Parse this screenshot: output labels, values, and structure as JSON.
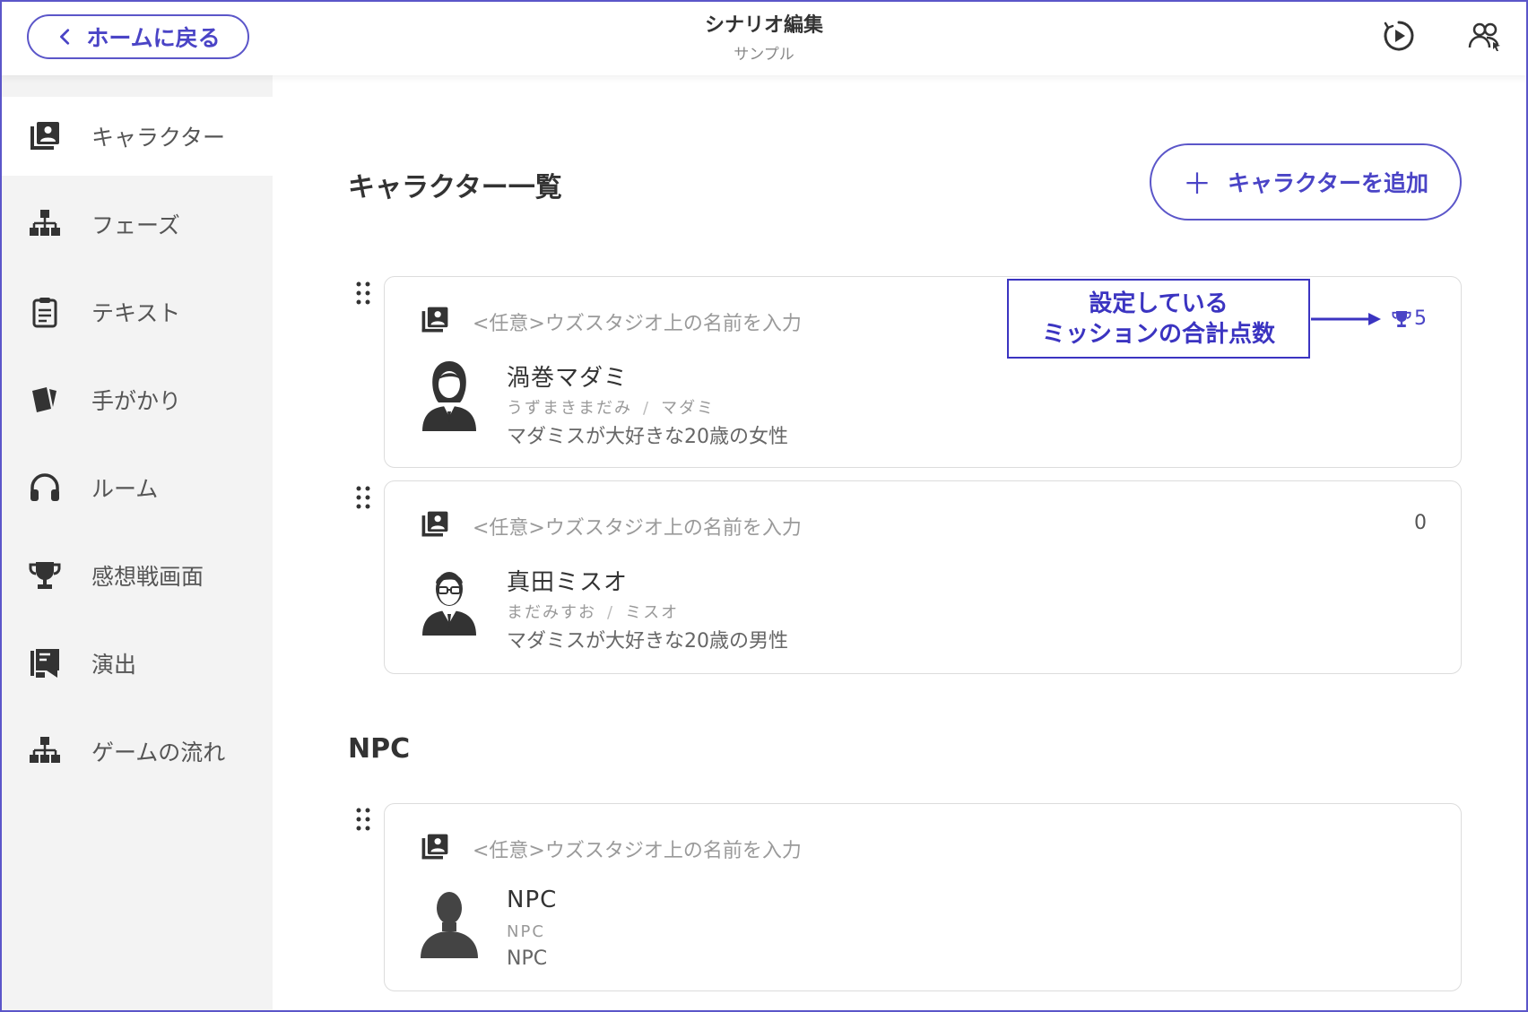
{
  "header": {
    "back_label": "ホームに戻る",
    "title": "シナリオ編集",
    "subtitle": "サンプル"
  },
  "sidebar": {
    "items": [
      {
        "label": "キャラクター",
        "icon": "character-icon",
        "active": true
      },
      {
        "label": "フェーズ",
        "icon": "hierarchy-icon"
      },
      {
        "label": "テキスト",
        "icon": "clipboard-icon"
      },
      {
        "label": "手がかり",
        "icon": "cards-icon"
      },
      {
        "label": "ルーム",
        "icon": "headphones-icon"
      },
      {
        "label": "感想戦画面",
        "icon": "trophy-icon"
      },
      {
        "label": "演出",
        "icon": "effects-icon"
      },
      {
        "label": "ゲームの流れ",
        "icon": "hierarchy-icon"
      }
    ]
  },
  "main": {
    "characters_title": "キャラクター一覧",
    "add_button_label": "キャラクターを追加",
    "npc_title": "NPC",
    "characters": [
      {
        "placeholder": "<任意>ウズスタジオ上の名前を入力",
        "score": "5",
        "score_icon": "trophy-icon",
        "name": "渦巻マダミ",
        "reading": "うずまきまだみ",
        "nickname": "マダミ",
        "description": "マダミスが大好きな20歳の女性"
      },
      {
        "placeholder": "<任意>ウズスタジオ上の名前を入力",
        "score": "0",
        "name": "真田ミスオ",
        "reading": "まだみすお",
        "nickname": "ミスオ",
        "description": "マダミスが大好きな20歳の男性"
      }
    ],
    "npcs": [
      {
        "placeholder": "<任意>ウズスタジオ上の名前を入力",
        "name": "NPC",
        "reading": "NPC",
        "description": "NPC"
      }
    ]
  },
  "annotation": {
    "line1": "設定している",
    "line2": "ミッションの合計点数"
  },
  "colors": {
    "accent": "#4a44c6",
    "sidebar_bg": "#f3f3f3"
  }
}
